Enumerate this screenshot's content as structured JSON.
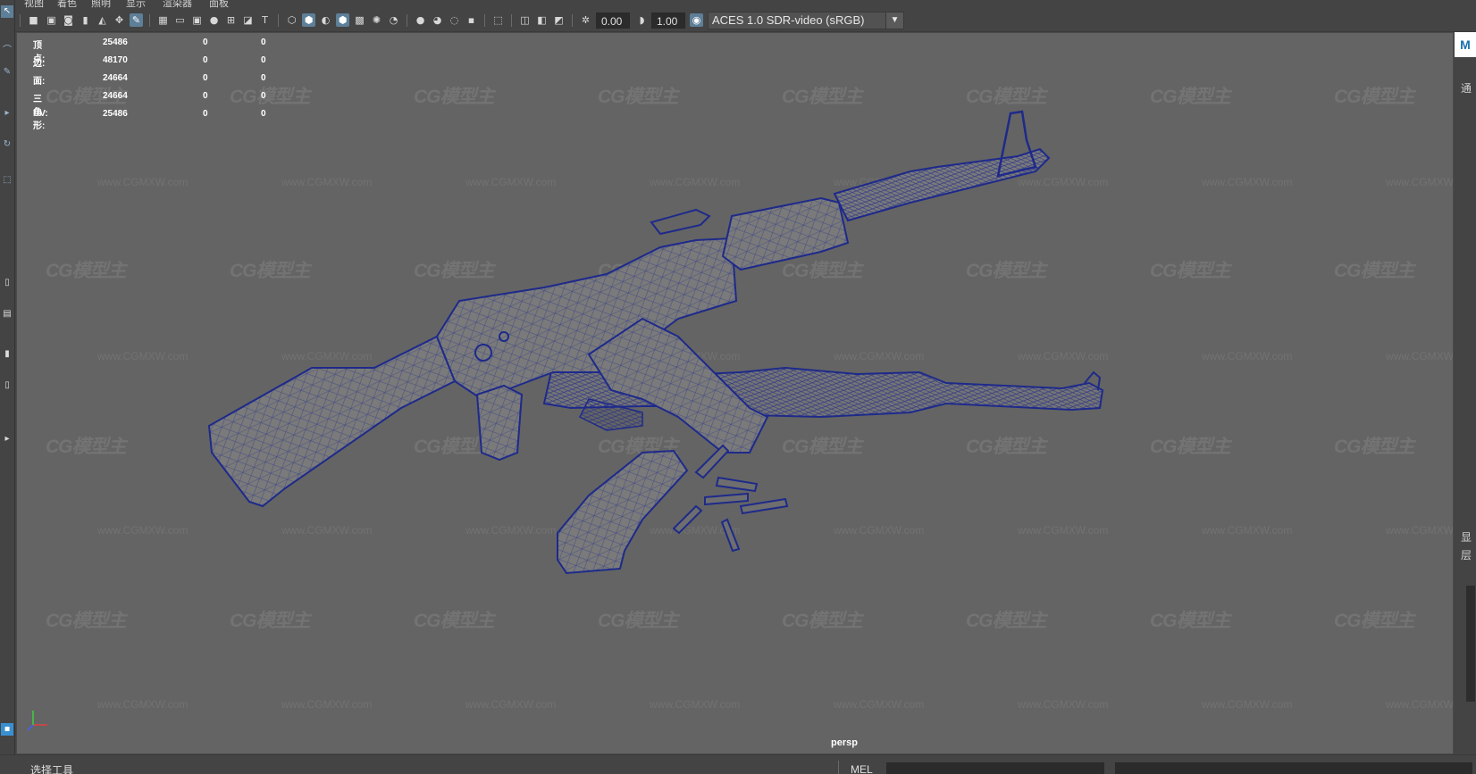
{
  "menu": {
    "items": [
      "视图",
      "着色",
      "照明",
      "显示",
      "渲染器",
      "面板"
    ]
  },
  "toolbar": {
    "exposure_value": "0.00",
    "gamma_value": "1.00",
    "color_space": "ACES 1.0 SDR-video (sRGB)",
    "icons": [
      "camera-icon",
      "camera-attributes-icon",
      "bookmark-icon",
      "image-plane-icon",
      "grid-icon",
      "film-gate-icon",
      "resolution-gate-icon",
      "gate-mask-icon",
      "field-chart-icon",
      "safe-action-icon",
      "safe-title-icon",
      "wireframe-icon",
      "smooth-shade-icon",
      "default-material-icon",
      "wireframe-on-shaded-icon",
      "textured-icon",
      "lights-icon",
      "shadows-icon",
      "screen-space-ao-icon",
      "motion-blur-icon",
      "anti-aliasing-icon",
      "depth-of-field-icon",
      "isolate-select-icon",
      "xray-icon",
      "xray-joints-icon",
      "xray-active-icon",
      "exposure-icon",
      "gamma-icon",
      "view-transform-icon"
    ]
  },
  "hud": {
    "rows": [
      {
        "label": "顶点:",
        "v1": "25486",
        "v2": "0",
        "v3": "0"
      },
      {
        "label": "边:",
        "v1": "48170",
        "v2": "0",
        "v3": "0"
      },
      {
        "label": "面:",
        "v1": "24664",
        "v2": "0",
        "v3": "0"
      },
      {
        "label": "三角形:",
        "v1": "24664",
        "v2": "0",
        "v3": "0"
      },
      {
        "label": "UV:",
        "v1": "25486",
        "v2": "0",
        "v3": "0"
      }
    ]
  },
  "watermark": {
    "logo_text": "CG模型主",
    "url_text": "www.CGMXW.com"
  },
  "viewport": {
    "camera": "persp",
    "wire_color": "#1e2a8a",
    "background": "#646464"
  },
  "right_panel": {
    "tab_icon": "M",
    "texts": [
      "通",
      "显",
      "层"
    ]
  },
  "status": {
    "tool_hint": "选择工具",
    "mel_label": "MEL"
  }
}
